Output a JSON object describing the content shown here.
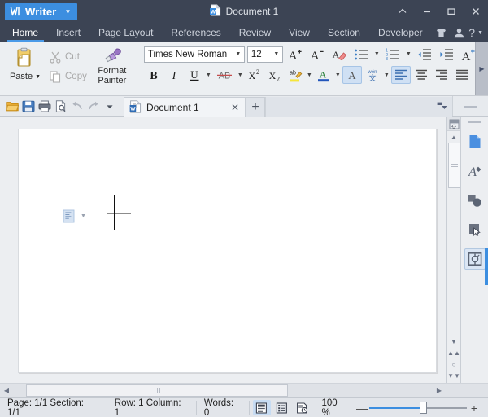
{
  "window": {
    "app_badge": "Writer",
    "document_title": "Document 1",
    "controls": {
      "collapse": "^",
      "minimize": "—",
      "restore": "❐",
      "close": "✕"
    }
  },
  "ribbon_tabs": {
    "items": [
      {
        "label": "Home",
        "active": true
      },
      {
        "label": "Insert",
        "active": false
      },
      {
        "label": "Page Layout",
        "active": false
      },
      {
        "label": "References",
        "active": false
      },
      {
        "label": "Review",
        "active": false
      },
      {
        "label": "View",
        "active": false
      },
      {
        "label": "Section",
        "active": false
      },
      {
        "label": "Developer",
        "active": false
      }
    ],
    "right_icons": [
      "skin-icon",
      "user-account-icon"
    ],
    "help_label": "?"
  },
  "ribbon": {
    "clipboard": {
      "paste_label": "Paste",
      "cut_label": "Cut",
      "copy_label": "Copy",
      "format_painter_line1": "Format",
      "format_painter_line2": "Painter"
    },
    "font": {
      "family_value": "Times New Roman",
      "size_value": "12",
      "bold_label": "B",
      "italic_label": "I",
      "underline_label": "U",
      "strikethrough_label": "AB",
      "superscript_label": "X",
      "superscript_sup": "2",
      "subscript_label": "X",
      "subscript_sub": "2",
      "highlight_label": "ab",
      "fontcolor_label": "A",
      "shading_label": "A",
      "grow_font_label": "A",
      "grow_font_sup": "+",
      "shrink_font_label": "A",
      "shrink_font_sup": "−",
      "clear_format_label": "A",
      "asian_layout_label": "wén"
    },
    "paragraph": {
      "bullets_icon": "bullet-list-icon",
      "numbering_icon": "numbered-list-icon",
      "decrease_indent_icon": "decrease-indent-icon",
      "increase_indent_icon": "increase-indent-icon",
      "asian_typography_icon": "asian-typography-icon",
      "borders_icon": "table-borders-icon",
      "show_marks_icon": "show-formatting-marks-icon",
      "align_left_icon": "align-left-icon",
      "align_center_icon": "align-center-icon",
      "align_right_icon": "align-right-icon",
      "justify_icon": "justify-icon",
      "distribute_icon": "distribute-icon",
      "line_spacing_icon": "line-spacing-icon",
      "shading_icon": "paragraph-shading-icon",
      "border_icon": "paragraph-border-icon"
    }
  },
  "tabstrip": {
    "quick_access": [
      "open-folder-icon",
      "save-icon",
      "print-icon",
      "print-preview-icon",
      "undo-icon",
      "redo-icon",
      "customize-dropdown-icon"
    ],
    "tabs": [
      {
        "label": "Document 1",
        "close": "✕",
        "active": true
      }
    ],
    "new_tab_label": "+"
  },
  "document": {
    "page_count_visible": 1,
    "cursor_present": true,
    "paragraph_mark": "paragraph-mark-icon"
  },
  "sidepanel": {
    "icons": [
      "document-properties-icon",
      "styles-icon",
      "shapes-icon",
      "selection-pane-icon",
      "refresh-object-icon"
    ]
  },
  "statusbar": {
    "page_info": "Page: 1/1 Section: 1/1",
    "cursor_info": "Row: 1 Column: 1",
    "word_count": "Words: 0",
    "views": [
      {
        "name": "print-layout-view",
        "active": true
      },
      {
        "name": "outline-view",
        "active": false
      },
      {
        "name": "web-layout-view",
        "active": false
      }
    ],
    "zoom_label": "100 %",
    "zoom_value": 100,
    "zoom_minus": "—",
    "zoom_plus": "+"
  },
  "colors": {
    "titlebar": "#3c4454",
    "accent": "#3c8ee0",
    "ribbon_bg": "#eceff2",
    "statusbar_bg": "#e2e5ea",
    "page_white": "#ffffff"
  }
}
